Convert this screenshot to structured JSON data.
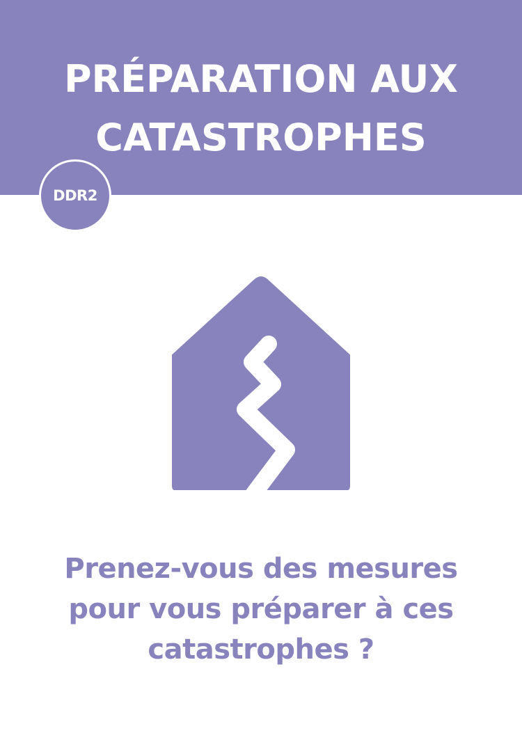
{
  "header": {
    "title_line1": "PRÉPARATION AUX",
    "title_line2": "CATASTROPHES",
    "background_color": "#8983bd"
  },
  "badge": {
    "label": "DDR2"
  },
  "icon": {
    "name": "house-earthquake-crack-icon",
    "color": "#8983bd"
  },
  "question": {
    "line1": "Prenez-vous des mesures",
    "line2": "pour vous préparer à ces",
    "line3": "catastrophes ?",
    "color": "#8983bd"
  }
}
